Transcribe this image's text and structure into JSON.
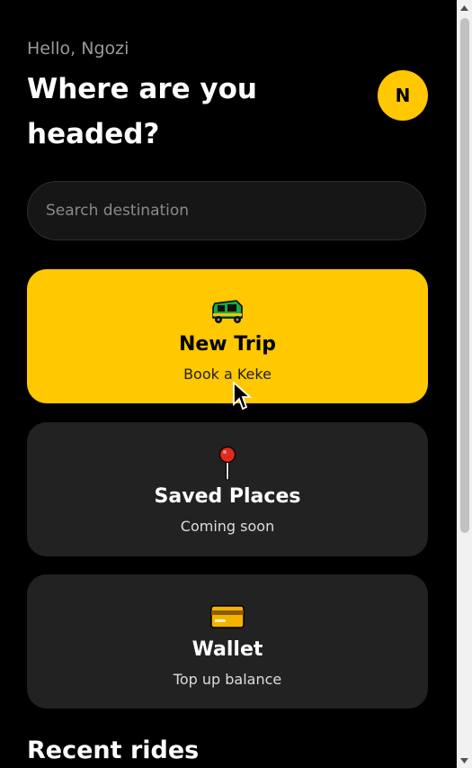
{
  "header": {
    "greeting": "Hello, Ngozi",
    "headline": "Where are you headed?",
    "avatar_initial": "N"
  },
  "search": {
    "placeholder": "Search destination",
    "value": ""
  },
  "cards": [
    {
      "title": "New Trip",
      "subtitle": "Book a Keke",
      "icon": "auto-rickshaw-icon"
    },
    {
      "title": "Saved Places",
      "subtitle": "Coming soon",
      "icon": "round-pushpin-icon"
    },
    {
      "title": "Wallet",
      "subtitle": "Top up balance",
      "icon": "credit-card-icon"
    }
  ],
  "recent": {
    "heading": "Recent rides"
  },
  "colors": {
    "accent": "#ffc800",
    "background": "#000000",
    "card": "#222222"
  }
}
